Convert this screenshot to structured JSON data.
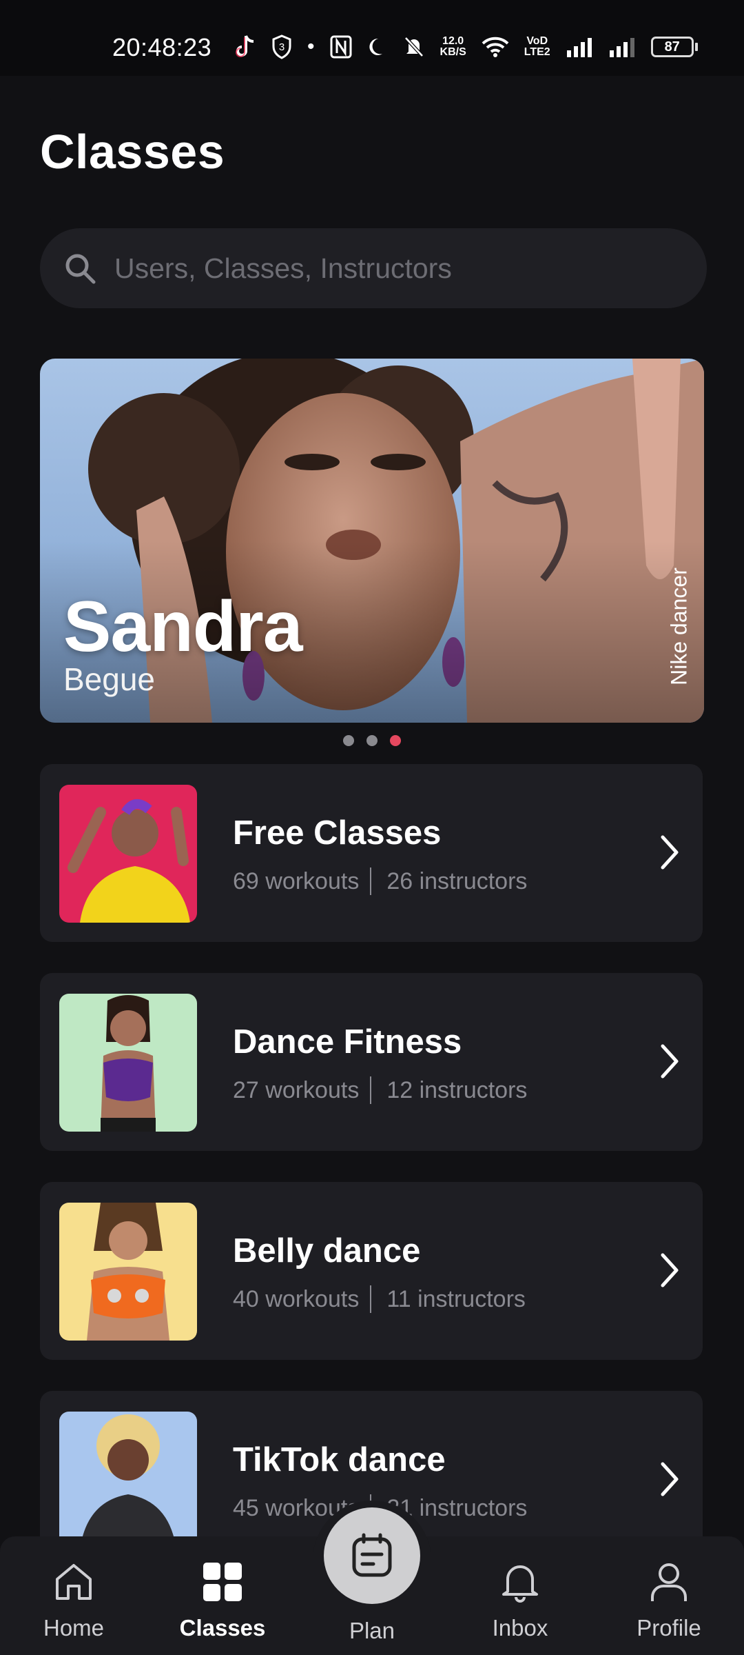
{
  "status_bar": {
    "time": "20:48:23",
    "notification_count": "3",
    "net_speed_top": "12.0",
    "net_speed_bottom": "KB/S",
    "volte_top": "VoD",
    "volte_bottom": "LTE2",
    "battery": "87"
  },
  "page": {
    "title": "Classes"
  },
  "search": {
    "placeholder": "Users, Classes, Instructors"
  },
  "hero": {
    "name": "Sandra",
    "surname": "Begue",
    "side_label": "Nike dancer",
    "active_slide": 3,
    "slide_count": 3
  },
  "classes": [
    {
      "title": "Free Classes",
      "workouts": "69 workouts",
      "instructors": "26 instructors"
    },
    {
      "title": "Dance Fitness",
      "workouts": "27 workouts",
      "instructors": "12 instructors"
    },
    {
      "title": "Belly dance",
      "workouts": "40 workouts",
      "instructors": "11 instructors"
    },
    {
      "title": "TikTok dance",
      "workouts": "45 workouts",
      "instructors": "21 instructors"
    }
  ],
  "nav": {
    "home": "Home",
    "classes": "Classes",
    "plan": "Plan",
    "inbox": "Inbox",
    "profile": "Profile",
    "active": "Classes"
  },
  "colors": {
    "background": "#111114",
    "card": "#1e1e23",
    "accent_dot": "#e5485f",
    "muted_text": "#8a8a91"
  }
}
